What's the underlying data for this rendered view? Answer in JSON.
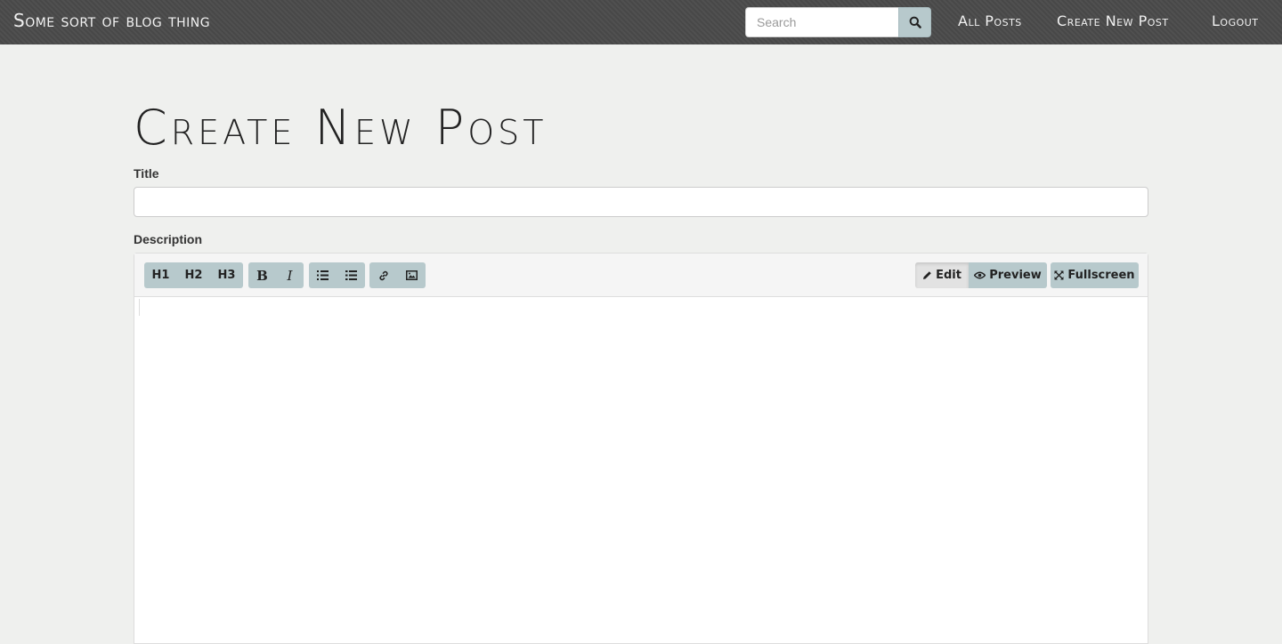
{
  "navbar": {
    "brand": "Some sort of blog thing",
    "search_placeholder": "Search",
    "links": [
      "All Posts",
      "Create New Post",
      "Logout"
    ]
  },
  "page": {
    "title": "Create New Post",
    "title_label": "Title",
    "title_value": "",
    "description_label": "Description"
  },
  "editor": {
    "heading_buttons": [
      "H1",
      "H2",
      "H3"
    ],
    "bold": "B",
    "italic": "I",
    "edit_label": "Edit",
    "preview_label": "Preview",
    "fullscreen_label": "Fullscreen",
    "active_mode": "Edit"
  },
  "colors": {
    "navbar_bg": "#4a4a4a",
    "button_bg": "#b7c9cc",
    "page_bg": "#eff0ee"
  }
}
